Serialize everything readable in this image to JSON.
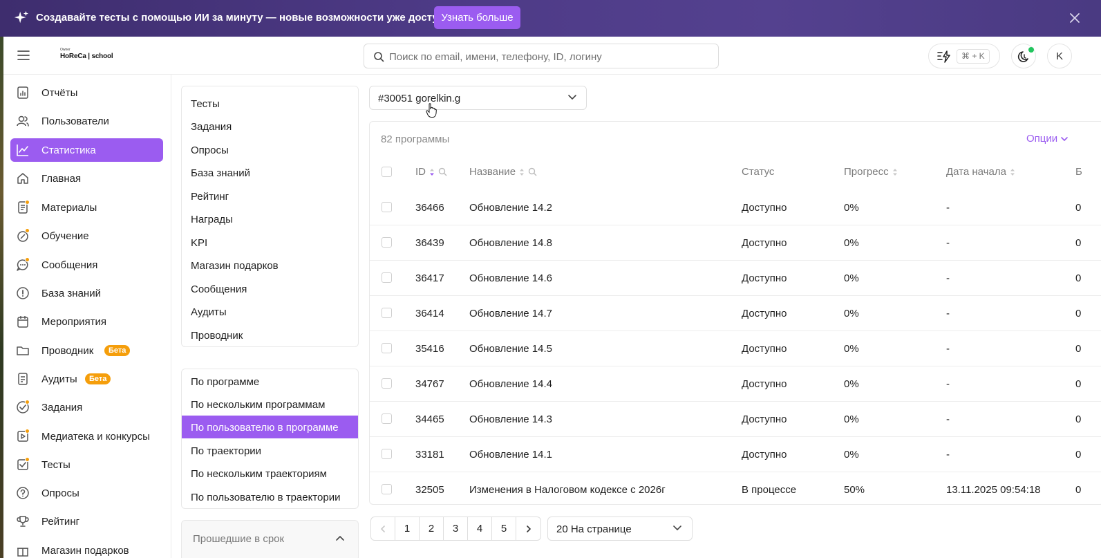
{
  "banner": {
    "text": "Создавайте тесты с помощью ИИ за минуту — новые возможности уже доступны!",
    "button": "Узнать больше"
  },
  "header": {
    "logo_small": "Owner",
    "logo_main": "HoReCa | school",
    "search_placeholder": "Поиск по email, имени, телефону, ID, логину",
    "shortcut": "⌘ + K",
    "avatar_letter": "K"
  },
  "sidebar": {
    "items": [
      {
        "label": "Отчёты",
        "icon": "report-icon"
      },
      {
        "label": "Пользователи",
        "icon": "users-icon"
      },
      {
        "label": "Статистика",
        "icon": "chart-icon",
        "active": true
      },
      {
        "label": "Главная",
        "icon": "home-icon"
      },
      {
        "label": "Материалы",
        "icon": "document-icon",
        "dot": true
      },
      {
        "label": "Обучение",
        "icon": "learning-icon",
        "dot": true
      },
      {
        "label": "Сообщения",
        "icon": "chat-icon",
        "dot": true
      },
      {
        "label": "База знаний",
        "icon": "info-icon"
      },
      {
        "label": "Мероприятия",
        "icon": "calendar-icon"
      },
      {
        "label": "Проводник",
        "icon": "folder-icon",
        "badge": "Бета"
      },
      {
        "label": "Аудиты",
        "icon": "checklist-icon",
        "badge": "Бета"
      },
      {
        "label": "Задания",
        "icon": "task-icon",
        "dot": true
      },
      {
        "label": "Медиатека и конкурсы",
        "icon": "media-icon",
        "dot": true
      },
      {
        "label": "Тесты",
        "icon": "test-icon",
        "dot": true
      },
      {
        "label": "Опросы",
        "icon": "question-icon"
      },
      {
        "label": "Рейтинг",
        "icon": "trophy-icon"
      },
      {
        "label": "Магазин подарков",
        "icon": "gift-icon"
      }
    ]
  },
  "submenu": {
    "sections": [
      "Тесты",
      "Задания",
      "Опросы",
      "База знаний",
      "Рейтинг",
      "Награды",
      "KPI",
      "Магазин подарков",
      "Сообщения",
      "Аудиты",
      "Проводник"
    ],
    "reports": [
      "По программе",
      "По нескольким программам",
      "По пользователю в программе",
      "По траектории",
      "По нескольким траекториям",
      "По пользователю в траектории"
    ],
    "active_report": "По пользователю в программе",
    "collapsible_title": "Прошедшие в срок"
  },
  "user_select": {
    "value": "#30051 gorelkin.g"
  },
  "table": {
    "count_label": "82 программы",
    "options_label": "Опции",
    "columns": [
      "ID",
      "Название",
      "Статус",
      "Прогресс",
      "Дата начала",
      "Б"
    ],
    "rows": [
      {
        "id": "36466",
        "name": "Обновление 14.2",
        "status": "Доступно",
        "progress": "0%",
        "start": "-",
        "extra": "0"
      },
      {
        "id": "36439",
        "name": "Обновление 14.8",
        "status": "Доступно",
        "progress": "0%",
        "start": "-",
        "extra": "0"
      },
      {
        "id": "36417",
        "name": "Обновление 14.6",
        "status": "Доступно",
        "progress": "0%",
        "start": "-",
        "extra": "0"
      },
      {
        "id": "36414",
        "name": "Обновление 14.7",
        "status": "Доступно",
        "progress": "0%",
        "start": "-",
        "extra": "0"
      },
      {
        "id": "35416",
        "name": "Обновление 14.5",
        "status": "Доступно",
        "progress": "0%",
        "start": "-",
        "extra": "0"
      },
      {
        "id": "34767",
        "name": "Обновление 14.4",
        "status": "Доступно",
        "progress": "0%",
        "start": "-",
        "extra": "0"
      },
      {
        "id": "34465",
        "name": "Обновление 14.3",
        "status": "Доступно",
        "progress": "0%",
        "start": "-",
        "extra": "0"
      },
      {
        "id": "33181",
        "name": "Обновление 14.1",
        "status": "Доступно",
        "progress": "0%",
        "start": "-",
        "extra": "0"
      },
      {
        "id": "32505",
        "name": "Изменения в Налоговом кодексе с 2026г",
        "status": "В процессе",
        "progress": "50%",
        "start": "13.11.2025 09:54:18",
        "extra": "0"
      }
    ]
  },
  "pagination": {
    "pages": [
      "1",
      "2",
      "3",
      "4",
      "5"
    ],
    "per_page": "20 На странице"
  },
  "colors": {
    "accent": "#9b5cf0",
    "banner": "#4d3a86",
    "badge": "#f59e0b"
  }
}
